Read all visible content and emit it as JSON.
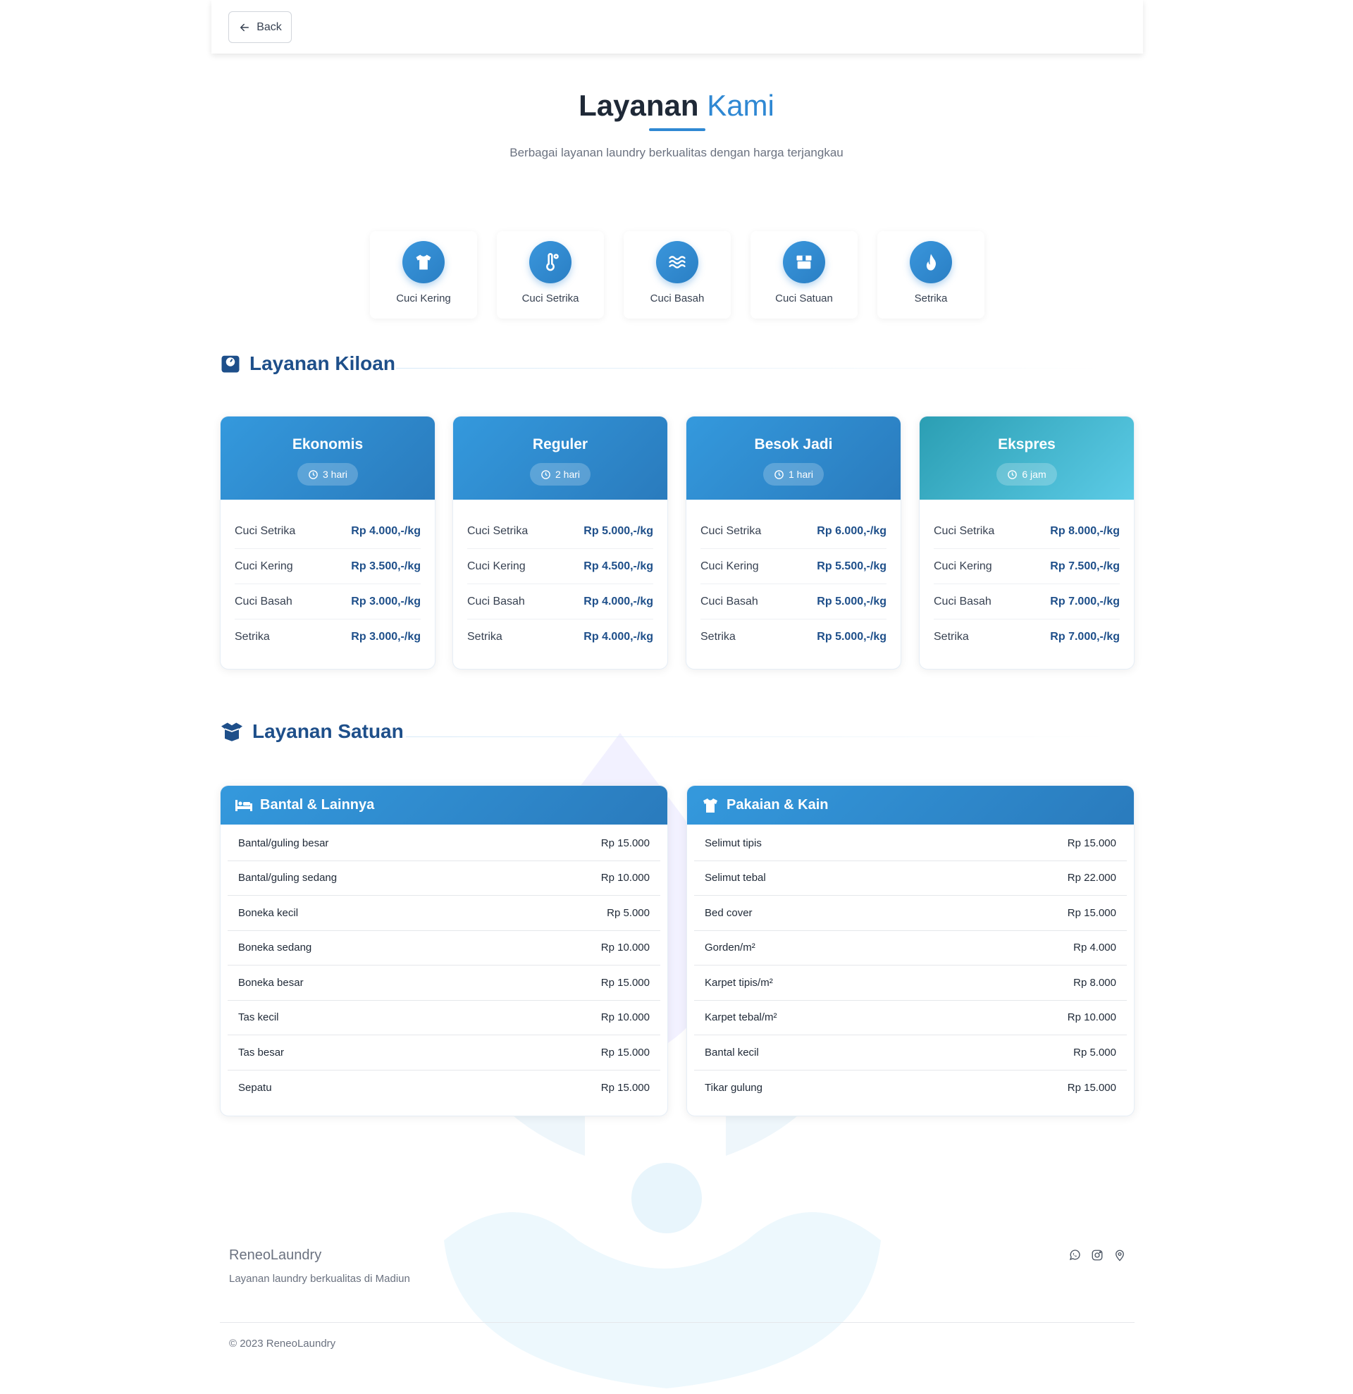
{
  "nav": {
    "back_label": "Back"
  },
  "hero": {
    "title_bold": "Layanan",
    "title_light": "Kami",
    "subtitle": "Berbagai layanan laundry berkualitas dengan harga terjangkau"
  },
  "quick_services": [
    {
      "label": "Cuci Kering",
      "icon": "tshirt-icon"
    },
    {
      "label": "Cuci Setrika",
      "icon": "thermometer-icon"
    },
    {
      "label": "Cuci Basah",
      "icon": "water-icon"
    },
    {
      "label": "Cuci Satuan",
      "icon": "box-icon"
    },
    {
      "label": "Setrika",
      "icon": "fire-icon"
    }
  ],
  "kiloan": {
    "heading": "Layanan Kiloan",
    "icon": "weight-scale-icon",
    "packages": [
      {
        "name": "Ekonomis",
        "duration": "3 hari",
        "color": "#2f88d3",
        "prices": [
          {
            "label": "Cuci Setrika",
            "price": "Rp 4.000,-/kg"
          },
          {
            "label": "Cuci Kering",
            "price": "Rp 3.500,-/kg"
          },
          {
            "label": "Cuci Basah",
            "price": "Rp 3.000,-/kg"
          },
          {
            "label": "Setrika",
            "price": "Rp 3.000,-/kg"
          }
        ]
      },
      {
        "name": "Reguler",
        "duration": "2 hari",
        "color": "#2f88d3",
        "prices": [
          {
            "label": "Cuci Setrika",
            "price": "Rp 5.000,-/kg"
          },
          {
            "label": "Cuci Kering",
            "price": "Rp 4.500,-/kg"
          },
          {
            "label": "Cuci Basah",
            "price": "Rp 4.000,-/kg"
          },
          {
            "label": "Setrika",
            "price": "Rp 4.000,-/kg"
          }
        ]
      },
      {
        "name": "Besok Jadi",
        "duration": "1 hari",
        "color": "#2f88d3",
        "prices": [
          {
            "label": "Cuci Setrika",
            "price": "Rp 6.000,-/kg"
          },
          {
            "label": "Cuci Kering",
            "price": "Rp 5.500,-/kg"
          },
          {
            "label": "Cuci Basah",
            "price": "Rp 5.000,-/kg"
          },
          {
            "label": "Setrika",
            "price": "Rp 5.000,-/kg"
          }
        ]
      },
      {
        "name": "Ekspres",
        "duration": "6 jam",
        "color": "#3bb3cf",
        "prices": [
          {
            "label": "Cuci Setrika",
            "price": "Rp 8.000,-/kg"
          },
          {
            "label": "Cuci Kering",
            "price": "Rp 7.500,-/kg"
          },
          {
            "label": "Cuci Basah",
            "price": "Rp 7.000,-/kg"
          },
          {
            "label": "Setrika",
            "price": "Rp 7.000,-/kg"
          }
        ]
      }
    ]
  },
  "satuan": {
    "heading": "Layanan Satuan",
    "icon": "open-box-icon",
    "groups": [
      {
        "title": "Bantal & Lainnya",
        "icon": "bed-icon",
        "items": [
          {
            "label": "Bantal/guling besar",
            "price": "Rp 15.000"
          },
          {
            "label": "Bantal/guling sedang",
            "price": "Rp 10.000"
          },
          {
            "label": "Boneka kecil",
            "price": "Rp 5.000"
          },
          {
            "label": "Boneka sedang",
            "price": "Rp 10.000"
          },
          {
            "label": "Boneka besar",
            "price": "Rp 15.000"
          },
          {
            "label": "Tas kecil",
            "price": "Rp 10.000"
          },
          {
            "label": "Tas besar",
            "price": "Rp 15.000"
          },
          {
            "label": "Sepatu",
            "price": "Rp 15.000"
          }
        ]
      },
      {
        "title": "Pakaian & Kain",
        "icon": "tshirt-icon",
        "items": [
          {
            "label": "Selimut tipis",
            "price": "Rp 15.000"
          },
          {
            "label": "Selimut tebal",
            "price": "Rp 22.000"
          },
          {
            "label": "Bed cover",
            "price": "Rp 15.000"
          },
          {
            "label": "Gorden/m²",
            "price": "Rp 4.000"
          },
          {
            "label": "Karpet tipis/m²",
            "price": "Rp 8.000"
          },
          {
            "label": "Karpet tebal/m²",
            "price": "Rp 10.000"
          },
          {
            "label": "Bantal kecil",
            "price": "Rp 5.000"
          },
          {
            "label": "Tikar gulung",
            "price": "Rp 15.000"
          }
        ]
      }
    ]
  },
  "footer": {
    "brand": "ReneoLaundry",
    "tagline": "Layanan laundry berkualitas di Madiun",
    "social_icons": [
      "whatsapp-icon",
      "instagram-icon",
      "location-pin-icon"
    ],
    "copyright": "© 2023 ReneoLaundry"
  },
  "colors": {
    "accent": "#2f88d3",
    "heading": "#1e4f8a",
    "teal": "#3bb3cf"
  }
}
